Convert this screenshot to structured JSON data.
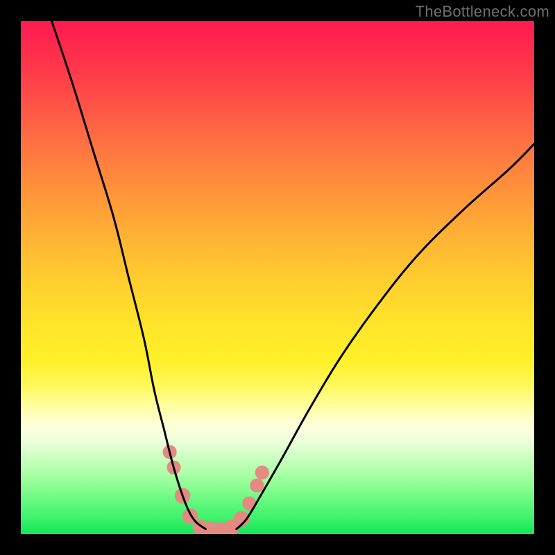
{
  "watermark": "TheBottleneck.com",
  "chart_data": {
    "type": "line",
    "title": "",
    "xlabel": "",
    "ylabel": "",
    "xlim": [
      0,
      100
    ],
    "ylim": [
      0,
      100
    ],
    "gradient_stops": [
      {
        "pct": 0,
        "color": "#ff1a4f"
      },
      {
        "pct": 10,
        "color": "#ff3a4a"
      },
      {
        "pct": 22,
        "color": "#ff6a44"
      },
      {
        "pct": 32,
        "color": "#ff8f3b"
      },
      {
        "pct": 42,
        "color": "#ffb234"
      },
      {
        "pct": 52,
        "color": "#ffd22e"
      },
      {
        "pct": 60,
        "color": "#ffe62a"
      },
      {
        "pct": 66,
        "color": "#fff028"
      },
      {
        "pct": 71,
        "color": "#fff85a"
      },
      {
        "pct": 75,
        "color": "#fffea0"
      },
      {
        "pct": 78,
        "color": "#ffffd0"
      },
      {
        "pct": 80,
        "color": "#faffe0"
      },
      {
        "pct": 82,
        "color": "#eaffd8"
      },
      {
        "pct": 84,
        "color": "#d5ffca"
      },
      {
        "pct": 87,
        "color": "#b8ffb0"
      },
      {
        "pct": 90,
        "color": "#95fe98"
      },
      {
        "pct": 93,
        "color": "#6dfa83"
      },
      {
        "pct": 97,
        "color": "#3cf26a"
      },
      {
        "pct": 100,
        "color": "#11e756"
      }
    ],
    "series": [
      {
        "name": "left-curve",
        "x": [
          6,
          10,
          14,
          18,
          21,
          24,
          26,
          28,
          29.5,
          31,
          32.5,
          34,
          36
        ],
        "y": [
          100,
          88,
          75,
          62,
          50,
          38,
          28,
          20,
          14,
          9,
          5,
          2.5,
          1
        ]
      },
      {
        "name": "right-curve",
        "x": [
          42,
          44,
          47,
          51,
          56,
          62,
          69,
          77,
          86,
          95,
          100
        ],
        "y": [
          1,
          3,
          8,
          15,
          24,
          34,
          44,
          54,
          63,
          71,
          76
        ]
      },
      {
        "name": "valley-floor",
        "x": [
          34,
          36,
          38,
          40,
          42
        ],
        "y": [
          2.5,
          1,
          0.7,
          1,
          2.5
        ]
      }
    ],
    "markers": [
      {
        "x": 29.0,
        "y": 16.0,
        "r": 1.5
      },
      {
        "x": 29.8,
        "y": 13.0,
        "r": 1.5
      },
      {
        "x": 31.5,
        "y": 7.5,
        "r": 1.8
      },
      {
        "x": 33.0,
        "y": 3.5,
        "r": 1.8
      },
      {
        "x": 35.0,
        "y": 1.3,
        "r": 1.8
      },
      {
        "x": 37.0,
        "y": 0.9,
        "r": 1.8
      },
      {
        "x": 39.0,
        "y": 0.8,
        "r": 1.8
      },
      {
        "x": 41.0,
        "y": 1.3,
        "r": 1.8
      },
      {
        "x": 43.0,
        "y": 3.0,
        "r": 1.8
      },
      {
        "x": 44.5,
        "y": 6.0,
        "r": 1.5
      },
      {
        "x": 46.0,
        "y": 9.5,
        "r": 1.5
      },
      {
        "x": 47.0,
        "y": 12.0,
        "r": 1.5
      }
    ],
    "marker_color": "#e58a83",
    "curve_color": "#000000",
    "curve_width": 3,
    "valley_marker_stroke_width": 11
  }
}
